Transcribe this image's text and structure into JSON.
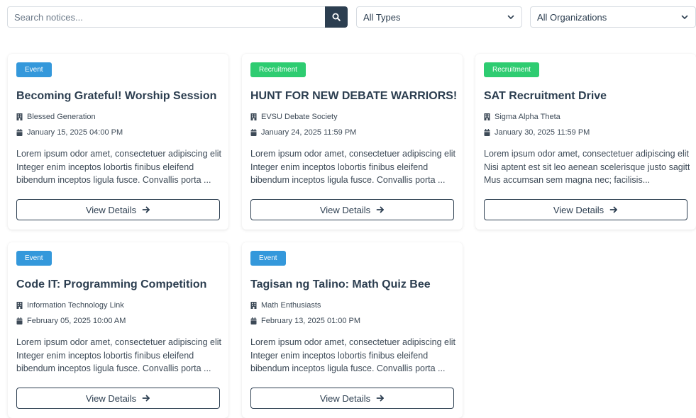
{
  "search": {
    "placeholder": "Search notices..."
  },
  "filters": {
    "type_selected": "All Types",
    "org_selected": "All Organizations"
  },
  "notices": [
    {
      "type": "Event",
      "title": "Becoming Grateful! Worship Session",
      "org": "Blessed Generation",
      "date": "January 15, 2025 04:00 PM",
      "desc": [
        "Lorem ipsum odor amet, consectetuer adipiscing elit.",
        "Integer enim inceptos lobortis finibus eleifend",
        "bibendum inceptos ligula fusce. Convallis porta ..."
      ],
      "button": "View Details"
    },
    {
      "type": "Recruitment",
      "title": "HUNT FOR NEW DEBATE WARRIORS!",
      "org": "EVSU Debate Society",
      "date": "January 24, 2025 11:59 PM",
      "desc": [
        "Lorem ipsum odor amet, consectetuer adipiscing elit.",
        "Integer enim inceptos lobortis finibus eleifend",
        "bibendum inceptos ligula fusce. Convallis porta ..."
      ],
      "button": "View Details"
    },
    {
      "type": "Recruitment",
      "title": "SAT Recruitment Drive",
      "org": "Sigma Alpha Theta",
      "date": "January 30, 2025 11:59 PM",
      "desc": [
        "Lorem ipsum odor amet, consectetuer adipiscing elit.",
        "Nisi aptent est sit leo aenean scelerisque justo sagittis.",
        "Mus accumsan sem magna nec; facilisis..."
      ],
      "button": "View Details"
    },
    {
      "type": "Event",
      "title": "Code IT: Programming Competition",
      "org": "Information Technology Link",
      "date": "February 05, 2025 10:00 AM",
      "desc": [
        "Lorem ipsum odor amet, consectetuer adipiscing elit.",
        "Integer enim inceptos lobortis finibus eleifend",
        "bibendum inceptos ligula fusce. Convallis porta ..."
      ],
      "button": "View Details"
    },
    {
      "type": "Event",
      "title": "Tagisan ng Talino: Math Quiz Bee",
      "org": "Math Enthusiasts",
      "date": "February 13, 2025 01:00 PM",
      "desc": [
        "Lorem ipsum odor amet, consectetuer adipiscing elit.",
        "Integer enim inceptos lobortis finibus eleifend",
        "bibendum inceptos ligula fusce. Convallis porta ..."
      ],
      "button": "View Details"
    }
  ],
  "colors": {
    "primary": "#2c3e50",
    "event": "#3498db",
    "recruitment": "#2ecc71"
  },
  "icons": {
    "search": "search-icon",
    "org": "building-icon",
    "date": "calendar-icon",
    "button": "arrow-right-icon",
    "dropdown": "chevron-down-icon"
  }
}
